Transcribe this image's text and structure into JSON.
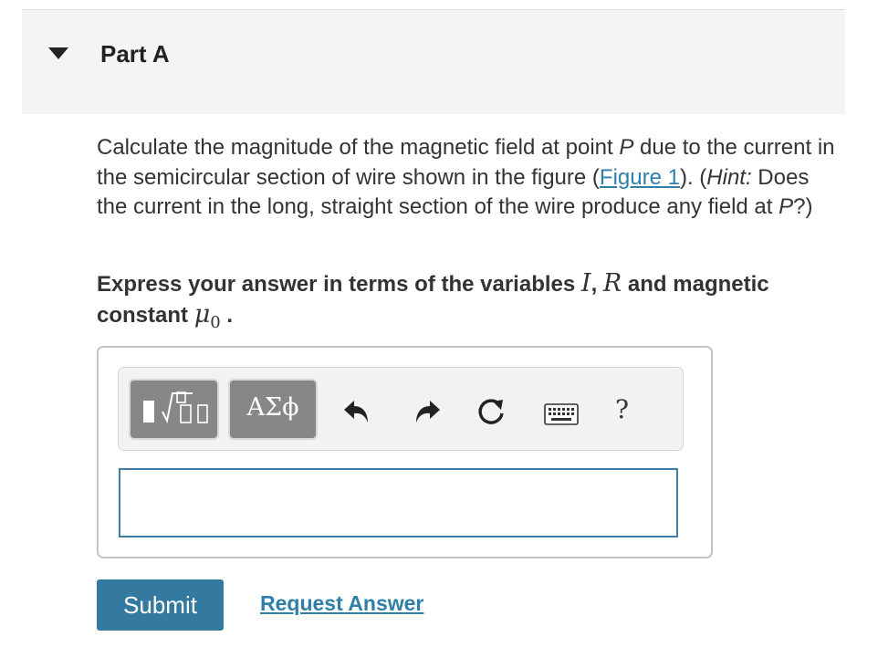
{
  "part": {
    "title": "Part A"
  },
  "question": {
    "line1_prefix": "Calculate the magnitude of the magnetic field at point ",
    "point_var": "P",
    "line1_suffix": " due to the current in the semicircular section of wire shown in the figure (",
    "figure_link": "Figure 1",
    "after_link": "). (",
    "hint_label": "Hint:",
    "hint_text": " Does the current in the long, straight section of the wire produce any field at ",
    "hint_end": "?)"
  },
  "instruction": {
    "prefix": "Express your answer in terms of the variables ",
    "var_i": "I",
    "comma": ", ",
    "var_r": "R",
    "middle": " and magnetic constant ",
    "mu": "μ",
    "mu_sub": "0",
    "end": " ."
  },
  "toolbar": {
    "templates_icon": "templates-icon",
    "symbols_label": "ΑΣϕ",
    "undo_icon": "undo-icon",
    "redo_icon": "redo-icon",
    "reset_icon": "reset-icon",
    "keyboard_icon": "keyboard-icon",
    "help_label": "?"
  },
  "answer": {
    "value": "",
    "placeholder": ""
  },
  "actions": {
    "submit_label": "Submit",
    "request_label": "Request Answer"
  },
  "colors": {
    "accent": "#347aa0",
    "link": "#2f7fa8",
    "header_bg": "#f4f4f4",
    "toolbar_button": "#878787"
  }
}
